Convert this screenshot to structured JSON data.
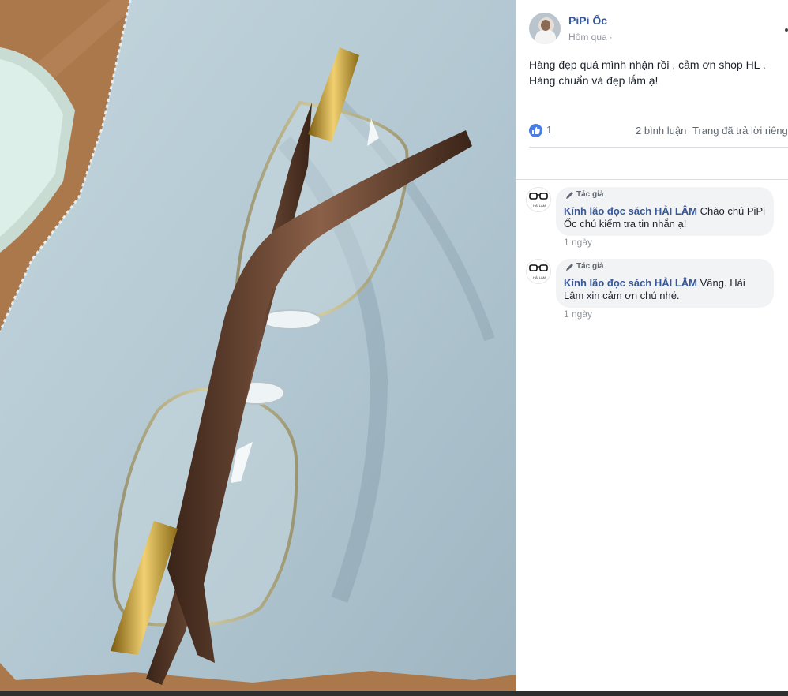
{
  "post": {
    "author": "PiPi Ốc",
    "time": "Hôm qua",
    "time_separator": "·",
    "text_line_1": "Hàng đẹp quá mình nhận rồi , cảm ơn shop HL .",
    "text_line_2": "Hàng chuẩn và đẹp lắm ạ!",
    "like_count": "1",
    "comments_count": "2 bình luận",
    "reply_status": "Trang đã trả lời riêng"
  },
  "comments": [
    {
      "badge": "Tác giả",
      "name": "Kính lão đọc sách HẢI LÂM",
      "text": " Chào chú PiPi Ốc chú kiểm tra tin nhắn ạ!",
      "time": "1 ngày"
    },
    {
      "badge": "Tác giả",
      "name": "Kính lão đọc sách HẢI LÂM",
      "text": " Vâng. Hải Lâm xin cảm ơn chú nhé.",
      "time": "1 ngày"
    }
  ],
  "page_avatar_text": "HẢI LÂM",
  "colors": {
    "link": "#385898",
    "meta": "#90949c",
    "bubble": "#f2f3f5",
    "like_blue": "#4a7de2"
  },
  "icons": [
    "thumbs-up-icon",
    "pencil-icon",
    "more-options-icon",
    "glasses-icon"
  ]
}
